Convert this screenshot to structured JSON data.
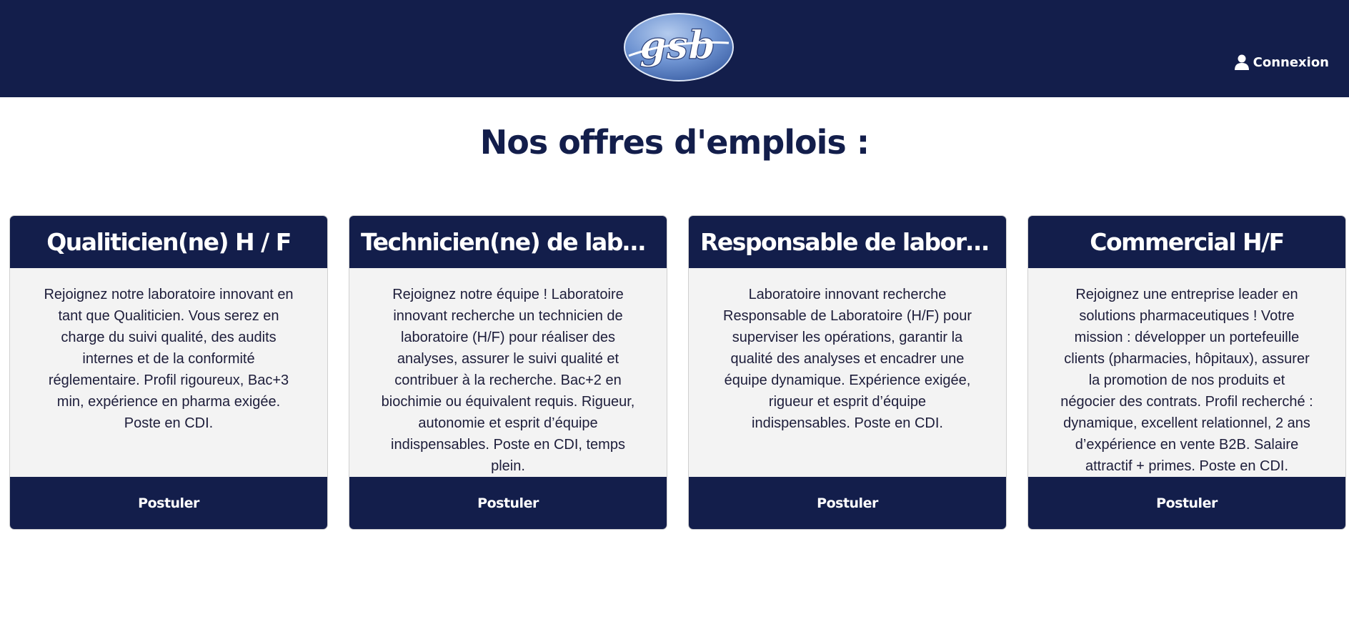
{
  "header": {
    "logo_text": "gsb",
    "login_label": "Connexion",
    "login_icon": "user-icon"
  },
  "page_title": "Nos offres d'emplois :",
  "offers": [
    {
      "title": "Qualiticien(ne) H / F",
      "description": "Rejoignez notre laboratoire innovant en tant que Qualiticien. Vous serez en charge du suivi qualité, des audits internes et de la conformité réglementaire. Profil rigoureux, Bac+3 min, expérience en pharma exigée. Poste en CDI.",
      "button_label": "Postuler"
    },
    {
      "title": "Technicien(ne) de laborat...",
      "description": "Rejoignez notre équipe ! Laboratoire innovant recherche un technicien de laboratoire (H/F) pour réaliser des analyses, assurer le suivi qualité et contribuer à la recherche. Bac+2 en biochimie ou équivalent requis. Rigueur, autonomie et esprit d’équipe indispensables. Poste en CDI, temps plein.",
      "button_label": "Postuler"
    },
    {
      "title": "Responsable de laboratoi...",
      "description": "Laboratoire innovant recherche Responsable de Laboratoire (H/F) pour superviser les opérations, garantir la qualité des analyses et encadrer une équipe dynamique. Expérience exigée, rigueur et esprit d’équipe indispensables. Poste en CDI.",
      "button_label": "Postuler"
    },
    {
      "title": "Commercial H/F",
      "description": "Rejoignez une entreprise leader en solutions pharmaceutiques ! Votre mission : développer un portefeuille clients (pharmacies, hôpitaux), assurer la promotion de nos produits et négocier des contrats. Profil recherché : dynamique, excellent relationnel, 2 ans d’expérience en vente B2B. Salaire attractif + primes. Poste en CDI.",
      "button_label": "Postuler"
    }
  ],
  "colors": {
    "navy": "#131e4b",
    "card_bg": "#f3f3f3",
    "logo_blue": "#5b82c8"
  }
}
